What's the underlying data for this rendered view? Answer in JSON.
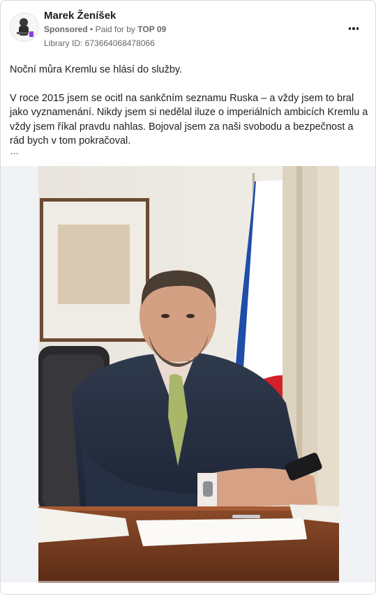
{
  "post": {
    "author_name": "Marek Ženíšek",
    "sponsored_label": "Sponsored",
    "paid_for_prefix": "Paid for by",
    "payer": "TOP 09",
    "library_id": "Library ID: 673664068478066",
    "more_icon": "more-horizontal-icon",
    "body_paragraphs": [
      "Noční můra Kremlu se hlásí do služby.",
      "V roce 2015 jsem se ocitl na sankčním seznamu Ruska – a vždy jsem to bral jako vyznamenání. Nikdy jsem si nedělal iluze o imperiálních ambicích Kremlu a vždy jsem říkal pravdu nahlas. Bojoval jsem za naši svobodu a bezpečnost a rád bych v tom pokračoval."
    ],
    "truncation": "…"
  },
  "colors": {
    "text": "#1c1e21",
    "secondary": "#65676b",
    "border": "#d6d9dd",
    "media_bg": "#f0f2f5"
  }
}
